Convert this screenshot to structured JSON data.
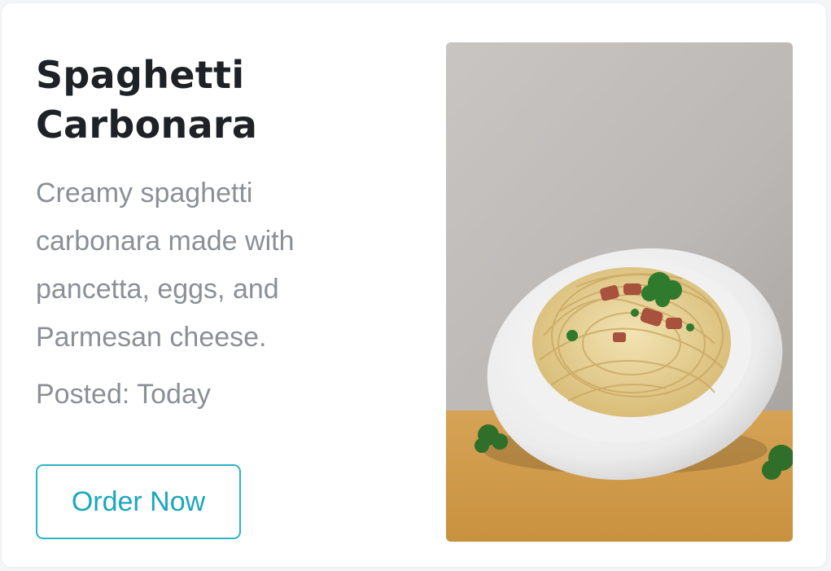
{
  "card": {
    "title": "Spaghetti Carbonara",
    "description": "Creamy spaghetti carbonara made with pancetta, eggs, and Parmesan cheese.",
    "posted": "Posted: Today",
    "button_label": "Order Now"
  },
  "image": {
    "subject": "spaghetti-carbonara-photo"
  },
  "colors": {
    "accent": "#2cb4c8",
    "title": "#1e2125",
    "muted_text": "#8b9096"
  }
}
